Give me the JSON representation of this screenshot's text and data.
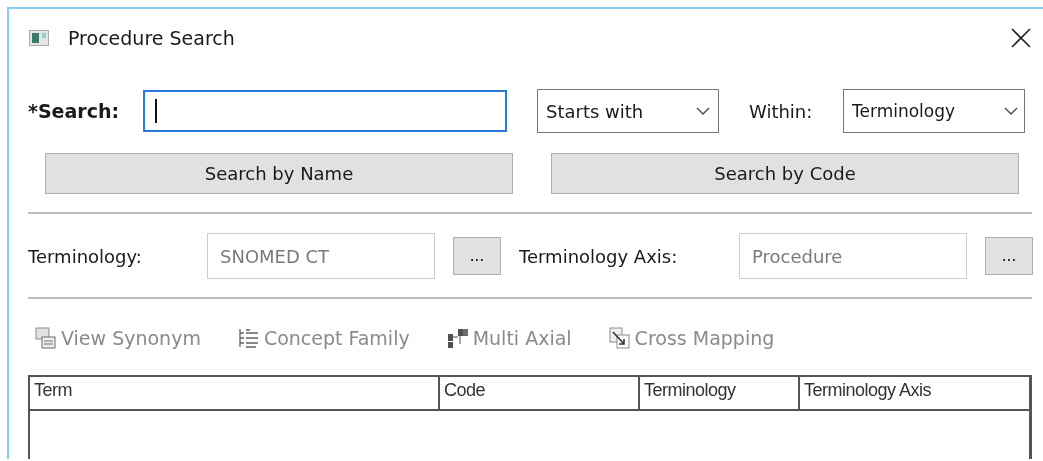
{
  "window": {
    "title": "Procedure Search"
  },
  "search": {
    "label": "*Search:",
    "focused": true,
    "match": "Starts with",
    "within_label": "Within:",
    "within": "Terminology"
  },
  "buttons": [
    "Search by Name",
    "Search by Code"
  ],
  "filters": [
    {
      "label": "Terminology:",
      "value": "SNOMED CT",
      "disabled": true,
      "button": "..."
    },
    {
      "label": "Terminology Axis:",
      "value": "Procedure",
      "disabled": true,
      "button": "..."
    }
  ],
  "toolbar": [
    {
      "kind": "synonym",
      "label": "View Synonym",
      "disabled": true
    },
    {
      "kind": "family",
      "label": "Concept Family",
      "disabled": true
    },
    {
      "kind": "axial",
      "label": "Multi Axial",
      "disabled": true
    },
    {
      "kind": "mapping",
      "label": "Cross Mapping",
      "disabled": true
    }
  ],
  "table": {
    "columns": [
      "Term",
      "Code",
      "Terminology",
      "Terminology Axis"
    ]
  }
}
